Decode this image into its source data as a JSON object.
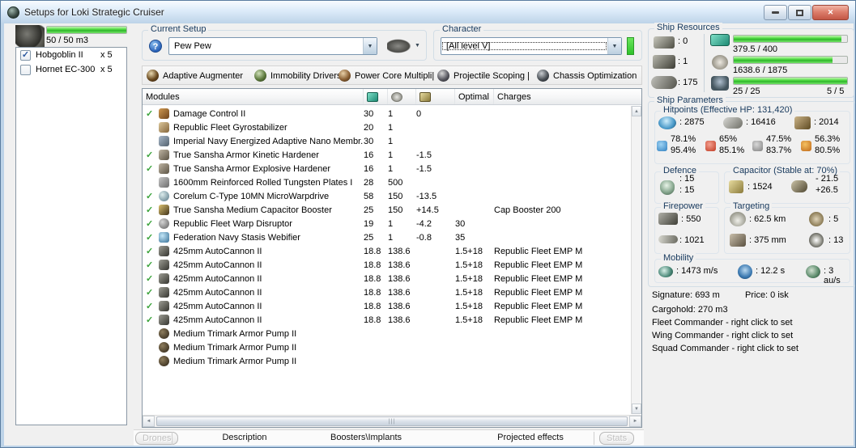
{
  "window": {
    "title": "Setups for Loki Strategic Cruiser"
  },
  "icons": {
    "check": "✓",
    "dropdown_arrow": "▼",
    "help": "?",
    "scroll_left": "◄",
    "scroll_right": "►",
    "scroll_up": "▲",
    "scroll_down": "▼",
    "grip": "|||"
  },
  "drones": {
    "capacity_label": "50 / 50 m3",
    "capacity_pct": 100,
    "items": [
      {
        "label": "Hobgoblin II",
        "qty": "x 5",
        "checked": true
      },
      {
        "label": "Hornet EC-300",
        "qty": "x 5",
        "checked": false
      }
    ]
  },
  "current_setup": {
    "label": "Current Setup",
    "value": "Pew Pew"
  },
  "character": {
    "label": "Character",
    "value": "[All level V]"
  },
  "subsystems": [
    {
      "label": "Adaptive Augmenter"
    },
    {
      "label": "Immobility Drivers"
    },
    {
      "label": "Power Core Multipli|"
    },
    {
      "label": "Projectile Scoping |"
    },
    {
      "label": "Chassis Optimization"
    }
  ],
  "modules_table": {
    "columns": {
      "modules": "Modules",
      "optimal": "Optimal",
      "charges": "Charges"
    },
    "rows": [
      {
        "active": true,
        "icon": "damage-control",
        "name": "Damage Control II",
        "cpu": "30",
        "pg": "1",
        "cap": "0",
        "optimal": "",
        "charges": ""
      },
      {
        "active": false,
        "icon": "gyro",
        "name": "Republic Fleet Gyrostabilizer",
        "cpu": "20",
        "pg": "1",
        "cap": "",
        "optimal": "",
        "charges": ""
      },
      {
        "active": false,
        "icon": "membrane",
        "name": "Imperial Navy Energized Adaptive Nano Membr...",
        "cpu": "30",
        "pg": "1",
        "cap": "",
        "optimal": "",
        "charges": ""
      },
      {
        "active": true,
        "icon": "hardener",
        "name": "True Sansha Armor Kinetic Hardener",
        "cpu": "16",
        "pg": "1",
        "cap": "-1.5",
        "optimal": "",
        "charges": ""
      },
      {
        "active": true,
        "icon": "hardener",
        "name": "True Sansha Armor Explosive Hardener",
        "cpu": "16",
        "pg": "1",
        "cap": "-1.5",
        "optimal": "",
        "charges": ""
      },
      {
        "active": false,
        "icon": "plate",
        "name": "1600mm Reinforced Rolled Tungsten Plates I",
        "cpu": "28",
        "pg": "500",
        "cap": "",
        "optimal": "",
        "charges": ""
      },
      {
        "active": true,
        "icon": "mwd",
        "name": "Corelum C-Type 10MN MicroWarpdrive",
        "cpu": "58",
        "pg": "150",
        "cap": "-13.5",
        "optimal": "",
        "charges": ""
      },
      {
        "active": true,
        "icon": "capbooster",
        "name": "True Sansha Medium Capacitor Booster",
        "cpu": "25",
        "pg": "150",
        "cap": "+14.5",
        "optimal": "",
        "charges": "Cap Booster 200"
      },
      {
        "active": true,
        "icon": "disruptor",
        "name": "Republic Fleet Warp Disruptor",
        "cpu": "19",
        "pg": "1",
        "cap": "-4.2",
        "optimal": "30",
        "charges": ""
      },
      {
        "active": true,
        "icon": "web",
        "name": "Federation Navy Stasis Webifier",
        "cpu": "25",
        "pg": "1",
        "cap": "-0.8",
        "optimal": "35",
        "charges": ""
      },
      {
        "active": true,
        "icon": "autocannon",
        "name": "425mm AutoCannon II",
        "cpu": "18.8",
        "pg": "138.6",
        "cap": "",
        "optimal": "1.5+18",
        "charges": "Republic Fleet EMP M"
      },
      {
        "active": true,
        "icon": "autocannon",
        "name": "425mm AutoCannon II",
        "cpu": "18.8",
        "pg": "138.6",
        "cap": "",
        "optimal": "1.5+18",
        "charges": "Republic Fleet EMP M"
      },
      {
        "active": true,
        "icon": "autocannon",
        "name": "425mm AutoCannon II",
        "cpu": "18.8",
        "pg": "138.6",
        "cap": "",
        "optimal": "1.5+18",
        "charges": "Republic Fleet EMP M"
      },
      {
        "active": true,
        "icon": "autocannon",
        "name": "425mm AutoCannon II",
        "cpu": "18.8",
        "pg": "138.6",
        "cap": "",
        "optimal": "1.5+18",
        "charges": "Republic Fleet EMP M"
      },
      {
        "active": true,
        "icon": "autocannon",
        "name": "425mm AutoCannon II",
        "cpu": "18.8",
        "pg": "138.6",
        "cap": "",
        "optimal": "1.5+18",
        "charges": "Republic Fleet EMP M"
      },
      {
        "active": true,
        "icon": "autocannon",
        "name": "425mm AutoCannon II",
        "cpu": "18.8",
        "pg": "138.6",
        "cap": "",
        "optimal": "1.5+18",
        "charges": "Republic Fleet EMP M"
      },
      {
        "active": false,
        "icon": "rig",
        "name": "Medium Trimark Armor Pump II",
        "cpu": "",
        "pg": "",
        "cap": "",
        "optimal": "",
        "charges": ""
      },
      {
        "active": false,
        "icon": "rig",
        "name": "Medium Trimark Armor Pump II",
        "cpu": "",
        "pg": "",
        "cap": "",
        "optimal": "",
        "charges": ""
      },
      {
        "active": false,
        "icon": "rig",
        "name": "Medium Trimark Armor Pump II",
        "cpu": "",
        "pg": "",
        "cap": "",
        "optimal": "",
        "charges": ""
      }
    ]
  },
  "bottom_tabs": {
    "drones": "Drones",
    "tabs": [
      "Description",
      "Boosters\\Implants",
      "Projected effects"
    ],
    "stats": "Stats"
  },
  "ship_resources": {
    "title": "Ship Resources",
    "turrets": ": 0",
    "launchers": ": 1",
    "calibration": ": 175",
    "cpu": {
      "text": "379.5 / 400",
      "pct": 94.9
    },
    "powergrid": {
      "text": "1638.6 / 1875",
      "pct": 87.4
    },
    "dronebay": {
      "left": "25 / 25",
      "right": "5 / 5",
      "pct": 100
    }
  },
  "ship_parameters": {
    "title": "Ship Parameters",
    "hitpoints": {
      "title": "Hitpoints (Effective HP: 131,420)",
      "shield": ": 2875",
      "armor": ": 16416",
      "hull": ": 2014",
      "resists": [
        {
          "type": "em",
          "line1": "78.1%",
          "line2": "95.4%"
        },
        {
          "type": "thermal",
          "line1": "65%",
          "line2": "85.1%"
        },
        {
          "type": "kinetic",
          "line1": "47.5%",
          "line2": "83.7%"
        },
        {
          "type": "explosive",
          "line1": "56.3%",
          "line2": "80.5%"
        }
      ]
    },
    "defence": {
      "title": "Defence",
      "line1": ": 15",
      "line2": ": 15"
    },
    "capacitor": {
      "title": "Capacitor (Stable at: 70%)",
      "amount": ": 1524",
      "drain": "- 21.5",
      "boost": "+26.5"
    },
    "firepower": {
      "title": "Firepower",
      "dps": ": 550",
      "volley": ": 1021"
    },
    "targeting": {
      "title": "Targeting",
      "range": ": 62.5 km",
      "sensor_strength": ": 5",
      "resolution": ": 375 mm",
      "max_targets": ": 13"
    },
    "mobility": {
      "title": "Mobility",
      "speed": ": 1473 m/s",
      "align": ": 12.2 s",
      "warp": ": 3 au/s"
    }
  },
  "footer": {
    "signature": "Signature: 693 m",
    "price": "Price: 0 isk",
    "cargohold": "Cargohold: 270 m3",
    "fleet": "Fleet Commander - right click to set",
    "wing": "Wing Commander - right click to set",
    "squad": "Squad Commander - right click to set"
  },
  "colors": {
    "accent_green": "#3fd433",
    "close_red": "#c35746",
    "check_green": "#3aa33a",
    "titlebar_blue": "#bdd3e8"
  }
}
